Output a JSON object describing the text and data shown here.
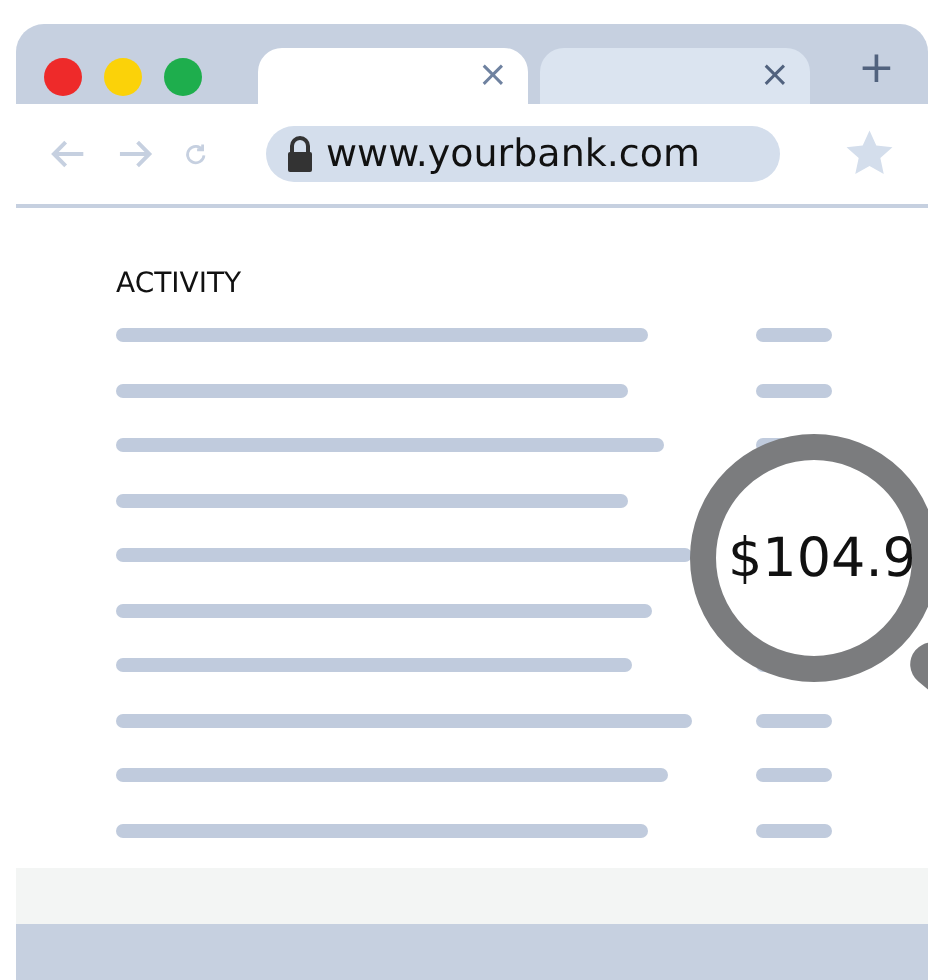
{
  "browser": {
    "tabs": [
      {
        "close": "×",
        "selected": true
      },
      {
        "close": "×",
        "selected": false
      }
    ],
    "new_tab": "+",
    "address": "www.yourbank.com"
  },
  "page": {
    "heading": "ACTIVITY",
    "magnified_amount": "$104.9"
  }
}
